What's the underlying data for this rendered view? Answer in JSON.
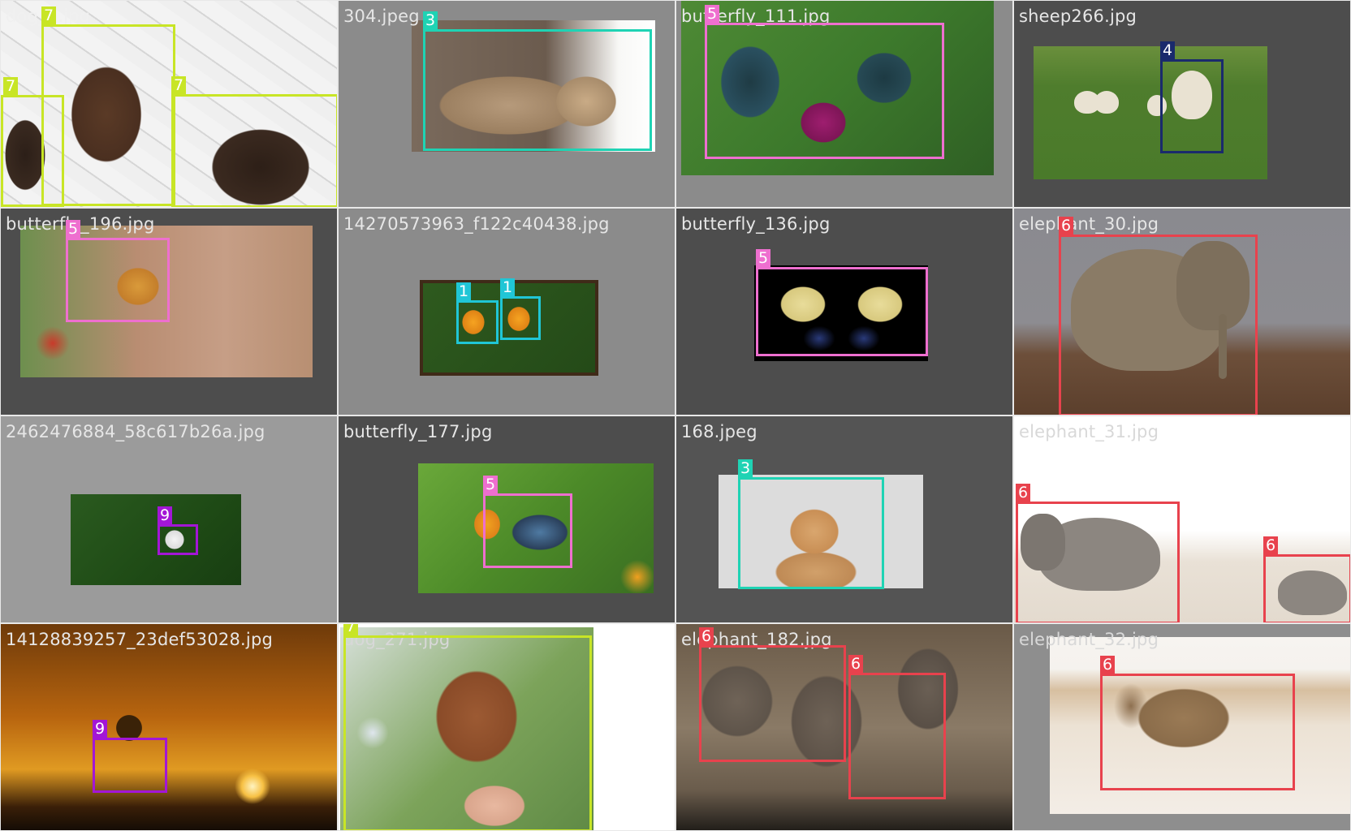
{
  "tiles": [
    {
      "filename": "dog_7.jpg",
      "boxes": [
        {
          "label": "7",
          "color": "#c8e526"
        },
        {
          "label": "7",
          "color": "#c8e526"
        },
        {
          "label": "7",
          "color": "#c8e526"
        }
      ]
    },
    {
      "filename": "304.jpeg",
      "boxes": [
        {
          "label": "3",
          "color": "#1fd3b4"
        }
      ]
    },
    {
      "filename": "butterfly_111.jpg",
      "boxes": [
        {
          "label": "5",
          "color": "#ee6fcf"
        }
      ]
    },
    {
      "filename": "sheep266.jpg",
      "boxes": [
        {
          "label": "4",
          "color": "#1a2a6c"
        }
      ]
    },
    {
      "filename": "butterfly_196.jpg",
      "boxes": [
        {
          "label": "5",
          "color": "#ee6fcf"
        }
      ]
    },
    {
      "filename": "14270573963_f122c40438.jpg",
      "boxes": [
        {
          "label": "1",
          "color": "#20c6d6"
        },
        {
          "label": "1",
          "color": "#20c6d6"
        }
      ]
    },
    {
      "filename": "butterfly_136.jpg",
      "boxes": [
        {
          "label": "5",
          "color": "#ee6fcf"
        }
      ]
    },
    {
      "filename": "elephant_30.jpg",
      "boxes": [
        {
          "label": "6",
          "color": "#e8424d"
        }
      ]
    },
    {
      "filename": "2462476884_58c617b26a.jpg",
      "boxes": [
        {
          "label": "9",
          "color": "#a316d6"
        }
      ]
    },
    {
      "filename": "butterfly_177.jpg",
      "boxes": [
        {
          "label": "5",
          "color": "#ee6fcf"
        }
      ]
    },
    {
      "filename": "168.jpeg",
      "boxes": [
        {
          "label": "3",
          "color": "#1fd3b4"
        }
      ]
    },
    {
      "filename": "elephant_31.jpg",
      "boxes": [
        {
          "label": "6",
          "color": "#e8424d"
        },
        {
          "label": "6",
          "color": "#e8424d"
        }
      ]
    },
    {
      "filename": "14128839257_23def53028.jpg",
      "boxes": [
        {
          "label": "9",
          "color": "#a316d6"
        }
      ]
    },
    {
      "filename": "dog_271.jpg",
      "boxes": [
        {
          "label": "7",
          "color": "#c8e526"
        }
      ]
    },
    {
      "filename": "elephant_182.jpg",
      "boxes": [
        {
          "label": "6",
          "color": "#e8424d"
        },
        {
          "label": "6",
          "color": "#e8424d"
        }
      ]
    },
    {
      "filename": "elephant_32.jpg",
      "boxes": [
        {
          "label": "6",
          "color": "#e8424d"
        }
      ]
    }
  ]
}
